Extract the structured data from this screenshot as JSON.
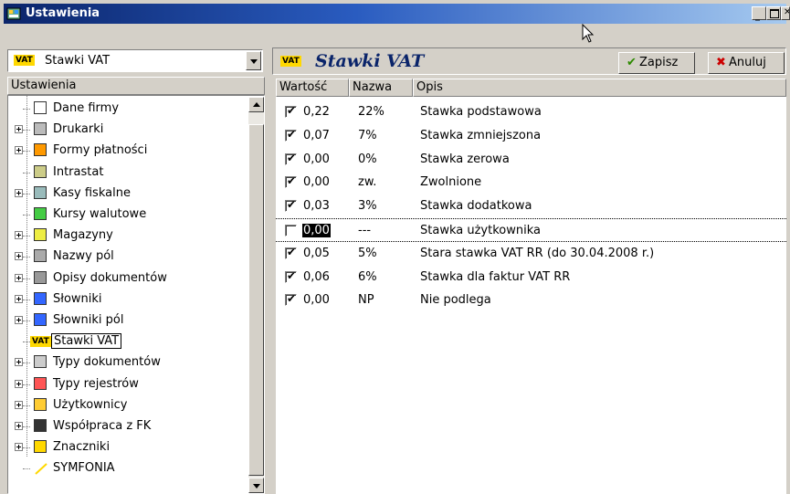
{
  "window": {
    "title": "Ustawienia"
  },
  "left": {
    "combo_badge": "VAT",
    "combo_value": "Stawki VAT",
    "tree_header": "Ustawienia",
    "tree": [
      {
        "label": "Dane firmy",
        "expandable": false,
        "icon": "form-icon"
      },
      {
        "label": "Drukarki",
        "expandable": true,
        "icon": "printer-icon"
      },
      {
        "label": "Formy płatności",
        "expandable": true,
        "icon": "payment-icon"
      },
      {
        "label": "Intrastat",
        "expandable": false,
        "icon": "intrastat-icon"
      },
      {
        "label": "Kasy fiskalne",
        "expandable": true,
        "icon": "cash-register-icon"
      },
      {
        "label": "Kursy walutowe",
        "expandable": false,
        "icon": "table-grid-icon"
      },
      {
        "label": "Magazyny",
        "expandable": true,
        "icon": "warehouse-box-icon"
      },
      {
        "label": "Nazwy pól",
        "expandable": true,
        "icon": "field-names-icon"
      },
      {
        "label": "Opisy dokumentów",
        "expandable": true,
        "icon": "document-desc-icon"
      },
      {
        "label": "Słowniki",
        "expandable": true,
        "icon": "dictionary-icon"
      },
      {
        "label": "Słowniki pól",
        "expandable": true,
        "icon": "field-dictionary-icon"
      },
      {
        "label": "Stawki VAT",
        "expandable": false,
        "icon": "vat-icon",
        "selected": true
      },
      {
        "label": "Typy dokumentów",
        "expandable": true,
        "icon": "document-types-icon"
      },
      {
        "label": "Typy rejestrów",
        "expandable": true,
        "icon": "register-types-icon"
      },
      {
        "label": "Użytkownicy",
        "expandable": true,
        "icon": "users-icon"
      },
      {
        "label": "Współpraca z FK",
        "expandable": true,
        "icon": "handshake-icon"
      },
      {
        "label": "Znaczniki",
        "expandable": true,
        "icon": "marker-icon"
      },
      {
        "label": "SYMFONIA",
        "expandable": false,
        "icon": "symfonia-icon"
      }
    ]
  },
  "right": {
    "badge": "VAT",
    "title": "Stawki VAT",
    "save_label": "Zapisz",
    "cancel_label": "Anuluj",
    "columns": [
      "Wartość",
      "Nazwa",
      "Opis"
    ],
    "rows": [
      {
        "checked": true,
        "value": "0,22",
        "name": "22%",
        "desc": "Stawka podstawowa"
      },
      {
        "checked": true,
        "value": "0,07",
        "name": "7%",
        "desc": "Stawka zmniejszona"
      },
      {
        "checked": true,
        "value": "0,00",
        "name": "0%",
        "desc": "Stawka zerowa"
      },
      {
        "checked": true,
        "value": "0,00",
        "name": "zw.",
        "desc": "Zwolnione"
      },
      {
        "checked": true,
        "value": "0,03",
        "name": "3%",
        "desc": "Stawka dodatkowa"
      },
      {
        "checked": false,
        "value": "0,00",
        "name": "---",
        "desc": "Stawka użytkownika",
        "editing": true
      },
      {
        "checked": true,
        "value": "0,05",
        "name": "5%",
        "desc": "Stara stawka VAT RR (do 30.04.2008 r.)"
      },
      {
        "checked": true,
        "value": "0,06",
        "name": "6%",
        "desc": "Stawka dla faktur VAT RR"
      },
      {
        "checked": true,
        "value": "0,00",
        "name": "NP",
        "desc": "Nie podlega"
      }
    ]
  },
  "colors": {
    "title_active": "#0a246a",
    "title_text": "#0a246a",
    "cancel_x": "#cc0000",
    "save_check": "#2d8a00",
    "vat_badge": "#ffd800"
  }
}
